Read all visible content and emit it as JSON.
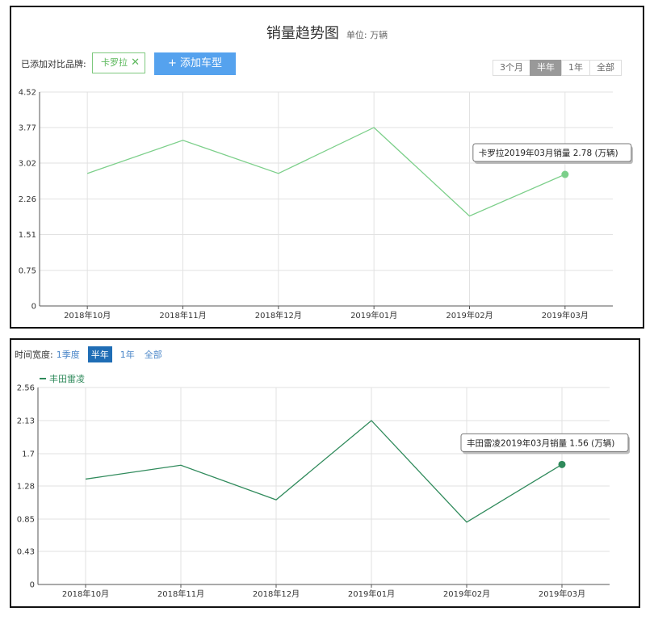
{
  "top": {
    "title": "销量趋势图",
    "unit": "单位: 万辆",
    "brand_label": "已添加对比品牌:",
    "brand_chip": "卡罗拉",
    "add_button": "+ 添加车型",
    "range_options": [
      "3个月",
      "半年",
      "1年",
      "全部"
    ],
    "range_active": 1
  },
  "bottom": {
    "width_label": "时间宽度:",
    "options": [
      "1季度",
      "半年",
      "1年",
      "全部"
    ],
    "active": 1
  },
  "chart_data": [
    {
      "type": "line",
      "categories": [
        "2018年10月",
        "2018年11月",
        "2018年12月",
        "2019年01月",
        "2019年02月",
        "2019年03月"
      ],
      "series": [
        {
          "values": [
            2.8,
            3.5,
            2.8,
            3.77,
            1.9,
            2.78
          ]
        }
      ],
      "yticks": [
        "0",
        "0.75",
        "1.51",
        "2.26",
        "3.02",
        "3.77",
        "4.52"
      ],
      "ylim": [
        0,
        4.52
      ],
      "color": "#7ccf8a",
      "tooltip": "卡罗拉2019年03月销量 2.78 (万辆)",
      "grid": true
    },
    {
      "type": "line",
      "categories": [
        "2018年10月",
        "2018年11月",
        "2018年12月",
        "2019年01月",
        "2019年02月",
        "2019年03月"
      ],
      "series": [
        {
          "name": "丰田雷凌",
          "values": [
            1.37,
            1.55,
            1.1,
            2.13,
            0.81,
            1.56
          ]
        }
      ],
      "yticks": [
        "0",
        "0.43",
        "0.85",
        "1.28",
        "1.7",
        "2.13",
        "2.56"
      ],
      "ylim": [
        0,
        2.56
      ],
      "color": "#2f8a5b",
      "tooltip": "丰田雷凌2019年03月销量 1.56 (万辆)",
      "legend": "top-left",
      "grid": true
    }
  ]
}
